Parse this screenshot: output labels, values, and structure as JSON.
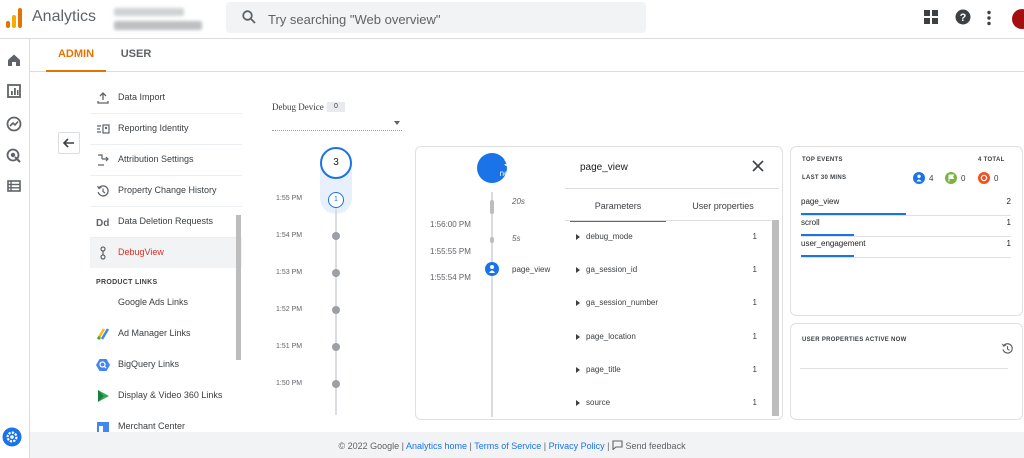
{
  "header": {
    "app_title": "Analytics",
    "search_placeholder": "Try searching \"Web overview\""
  },
  "tabs": {
    "admin": "ADMIN",
    "user": "USER"
  },
  "admin_nav": {
    "items": [
      {
        "label": "Data Import",
        "icon": "upload-icon"
      },
      {
        "label": "Reporting Identity",
        "icon": "reporting-identity-icon"
      },
      {
        "label": "Attribution Settings",
        "icon": "attribution-icon"
      },
      {
        "label": "Property Change History",
        "icon": "history-icon"
      },
      {
        "label": "Data Deletion Requests",
        "icon": "dd-icon"
      },
      {
        "label": "DebugView",
        "icon": "debug-icon",
        "active": true
      }
    ],
    "section_label": "PRODUCT LINKS",
    "links": [
      {
        "label": "Google Ads Links",
        "icon": "google-ads-icon"
      },
      {
        "label": "Ad Manager Links",
        "icon": "ad-manager-icon"
      },
      {
        "label": "BigQuery Links",
        "icon": "bigquery-icon"
      },
      {
        "label": "Display & Video 360 Links",
        "icon": "dv360-icon"
      },
      {
        "label": "Merchant Center",
        "icon": "merchant-center-icon"
      }
    ]
  },
  "debug_device": {
    "label": "Debug Device",
    "count": "0"
  },
  "minute_stream": {
    "top_count": "3",
    "current_count": "1",
    "times": [
      "1:55 PM",
      "1:54 PM",
      "1:53 PM",
      "1:52 PM",
      "1:51 PM",
      "1:50 PM"
    ]
  },
  "seconds_stream": {
    "bubble_count": "3",
    "bubble_text": "new",
    "gaps": [
      "20s",
      "5s"
    ],
    "times": [
      "1:56:00 PM",
      "1:55:55 PM",
      "1:55:54 PM"
    ],
    "event_label": "page_view"
  },
  "param_panel": {
    "title": "page_view",
    "tab_params": "Parameters",
    "tab_user": "User properties",
    "params": [
      {
        "name": "debug_mode",
        "value": "1"
      },
      {
        "name": "ga_session_id",
        "value": "1"
      },
      {
        "name": "ga_session_number",
        "value": "1"
      },
      {
        "name": "page_location",
        "value": "1"
      },
      {
        "name": "page_title",
        "value": "1"
      },
      {
        "name": "source",
        "value": "1"
      }
    ]
  },
  "top_events": {
    "title": "TOP EVENTS",
    "total": "4 TOTAL",
    "range": "LAST 30 MINS",
    "chips": [
      {
        "count": "4",
        "color": "#1a73e8",
        "icon": "person-icon"
      },
      {
        "count": "0",
        "color": "#7cb342",
        "icon": "flag-icon"
      },
      {
        "count": "0",
        "color": "#f4511e",
        "icon": "error-icon"
      }
    ],
    "rows": [
      {
        "name": "page_view",
        "count": "2",
        "fraction": 0.5
      },
      {
        "name": "scroll",
        "count": "1",
        "fraction": 0.25
      },
      {
        "name": "user_engagement",
        "count": "1",
        "fraction": 0.25
      }
    ]
  },
  "user_properties": {
    "title": "USER PROPERTIES ACTIVE NOW"
  },
  "footer": {
    "copyright": "© 2022 Google |",
    "analytics_home": "Analytics home",
    "sep1": "|",
    "terms": "Terms of Service",
    "sep2": "|",
    "privacy": "Privacy Policy",
    "sep3": "|",
    "feedback": "Send feedback"
  },
  "colors": {
    "accent": "#1a73e8",
    "admin_tab": "#e37400",
    "debug_active": "#d93025"
  }
}
